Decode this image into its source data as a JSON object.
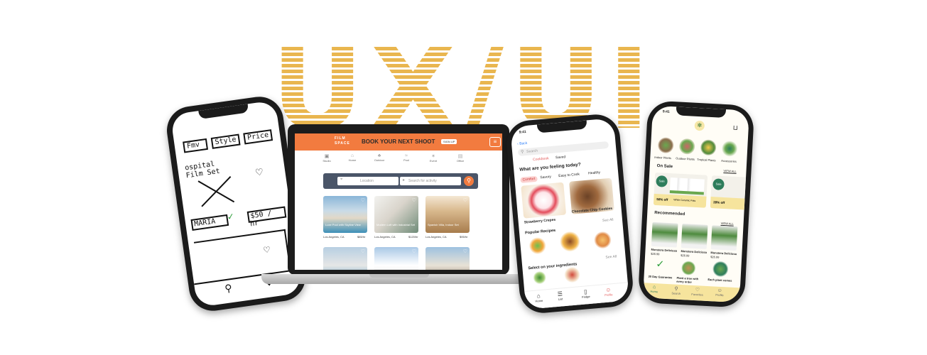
{
  "title": "UX/UI",
  "sketch": {
    "filter_1": "Fmv",
    "filter_2": "Style",
    "filter_3": "Price",
    "card_title": "ospital Film Set",
    "card_name": "MARIA",
    "card_price": "$50 / hr"
  },
  "filmspace": {
    "logo_line1": "FILM",
    "logo_line2": "SPACE",
    "headline": "BOOK YOUR NEXT SHOOT",
    "signup_label": "SIGN UP",
    "location_placeholder": "Location",
    "activity_placeholder": "Search for activity",
    "categories": [
      "Studio",
      "Home",
      "Outdoor",
      "Pool",
      "Event",
      "Office"
    ],
    "listings": [
      {
        "title": "Luxe Pool with Skyline View",
        "location": "Los Angeles, CA",
        "price": "$85/hr"
      },
      {
        "title": "Modern Loft with Industrial Set",
        "location": "Los Angeles, CA",
        "price": "$120/hr"
      },
      {
        "title": "Spanish Villa, Indoor Set",
        "location": "Los Angeles, CA",
        "price": "$95/hr"
      }
    ]
  },
  "recipe_app": {
    "time": "9:41",
    "back_label": "Back",
    "search_placeholder": "Search",
    "tabs": [
      "Cookbook",
      "Saved"
    ],
    "question": "What are you feeling today?",
    "moods": [
      "Comfort",
      "Savory",
      "Easy to Cook",
      "Healthy"
    ],
    "recipe_1": "Strawberry Crepes",
    "recipe_2": "Chocolate Chip Cookies",
    "popular_label": "Popular Recipes",
    "see_all": "See All",
    "ingredients_label": "Select on your ingredients",
    "nav": [
      "Home",
      "List",
      "Fridge",
      "Profile"
    ]
  },
  "plant_app": {
    "time": "9:41",
    "categories": [
      "Indoor Plants",
      "Outdoor Plants",
      "Tropical Plants",
      "Accessories"
    ],
    "on_sale_label": "On Sale",
    "view_all": "VIEW ALL",
    "sale_badge": "Sale",
    "sale_1_discount": "50% off",
    "sale_1_name": "White Ceramic Pots",
    "sale_2_discount": "28% off",
    "recommended_label": "Recommended",
    "products": [
      {
        "name": "Monstera Deliciosa",
        "price": "$26.99"
      },
      {
        "name": "Monstera Deliciosa",
        "price": "$26.99"
      },
      {
        "name": "Monstera Deliciosa",
        "price": "$26.99"
      }
    ],
    "promos": [
      "30 Day Guarantee",
      "Plant a tree with every order",
      "Each plant comes"
    ],
    "nav": [
      "Home",
      "Search",
      "Favorites",
      "Profile"
    ]
  }
}
